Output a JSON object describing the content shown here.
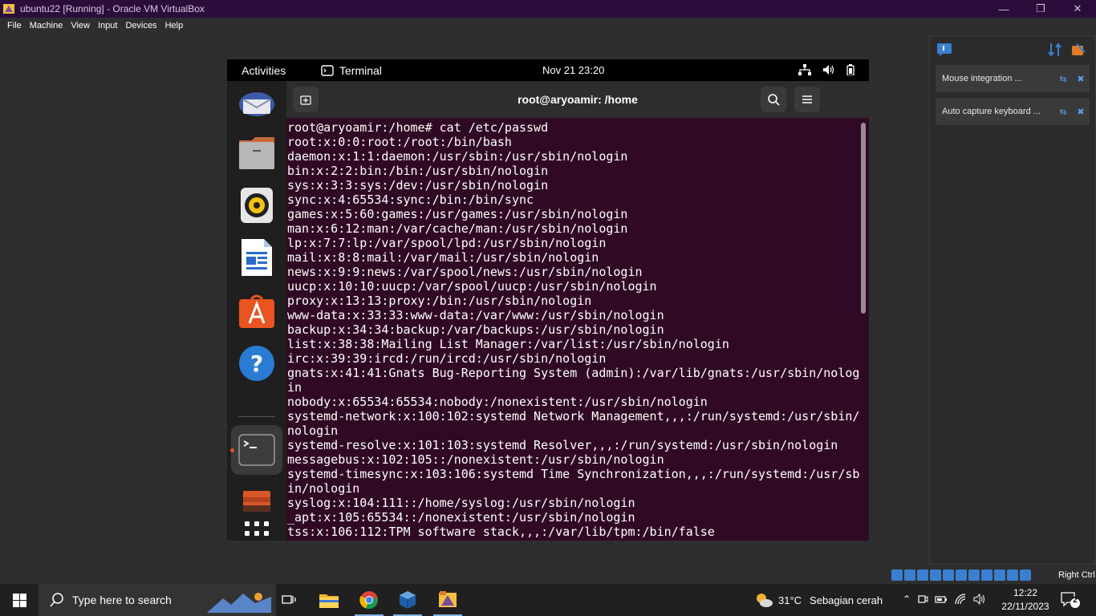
{
  "vbox": {
    "window_title": "ubuntu22 [Running] - Oracle VM VirtualBox",
    "menu": [
      "File",
      "Machine",
      "View",
      "Input",
      "Devices",
      "Help"
    ],
    "notices": [
      {
        "text": "Mouse integration ..."
      },
      {
        "text": "Auto capture keyboard ..."
      }
    ],
    "host_key": "Right Ctrl"
  },
  "ubuntu": {
    "activities": "Activities",
    "app_name": "Terminal",
    "clock": "Nov 21  23:20",
    "dock_icons": [
      "thunderbird-icon",
      "files-icon",
      "rhythmbox-icon",
      "writer-icon",
      "app-center-icon",
      "help-icon",
      "terminal-icon",
      "image-viewer-icon",
      "show-apps-icon"
    ]
  },
  "terminal": {
    "title": "root@aryoamir: /home",
    "output": "root@aryoamir:/home# cat /etc/passwd\nroot:x:0:0:root:/root:/bin/bash\ndaemon:x:1:1:daemon:/usr/sbin:/usr/sbin/nologin\nbin:x:2:2:bin:/bin:/usr/sbin/nologin\nsys:x:3:3:sys:/dev:/usr/sbin/nologin\nsync:x:4:65534:sync:/bin:/bin/sync\ngames:x:5:60:games:/usr/games:/usr/sbin/nologin\nman:x:6:12:man:/var/cache/man:/usr/sbin/nologin\nlp:x:7:7:lp:/var/spool/lpd:/usr/sbin/nologin\nmail:x:8:8:mail:/var/mail:/usr/sbin/nologin\nnews:x:9:9:news:/var/spool/news:/usr/sbin/nologin\nuucp:x:10:10:uucp:/var/spool/uucp:/usr/sbin/nologin\nproxy:x:13:13:proxy:/bin:/usr/sbin/nologin\nwww-data:x:33:33:www-data:/var/www:/usr/sbin/nologin\nbackup:x:34:34:backup:/var/backups:/usr/sbin/nologin\nlist:x:38:38:Mailing List Manager:/var/list:/usr/sbin/nologin\nirc:x:39:39:ircd:/run/ircd:/usr/sbin/nologin\ngnats:x:41:41:Gnats Bug-Reporting System (admin):/var/lib/gnats:/usr/sbin/nolog\nin\nnobody:x:65534:65534:nobody:/nonexistent:/usr/sbin/nologin\nsystemd-network:x:100:102:systemd Network Management,,,:/run/systemd:/usr/sbin/\nnologin\nsystemd-resolve:x:101:103:systemd Resolver,,,:/run/systemd:/usr/sbin/nologin\nmessagebus:x:102:105::/nonexistent:/usr/sbin/nologin\nsystemd-timesync:x:103:106:systemd Time Synchronization,,,:/run/systemd:/usr/sb\nin/nologin\nsyslog:x:104:111::/home/syslog:/usr/sbin/nologin\n_apt:x:105:65534::/nonexistent:/usr/sbin/nologin\ntss:x:106:112:TPM software stack,,,:/var/lib/tpm:/bin/false"
  },
  "taskbar": {
    "search_placeholder": "Type here to search",
    "apps": [
      "task-view-icon",
      "file-explorer-icon",
      "chrome-icon",
      "virtualbox-icon",
      "virtualbox-vm-icon"
    ],
    "weather_temp": "31°C",
    "weather_condition": "Sebagian cerah",
    "time": "12:22",
    "date": "22/11/2023",
    "notification_count": "2"
  },
  "colors": {
    "terminal_bg": "#300a24",
    "vbox_titlebar": "#2b0d3c",
    "ubuntu_accent": "#e95420"
  }
}
